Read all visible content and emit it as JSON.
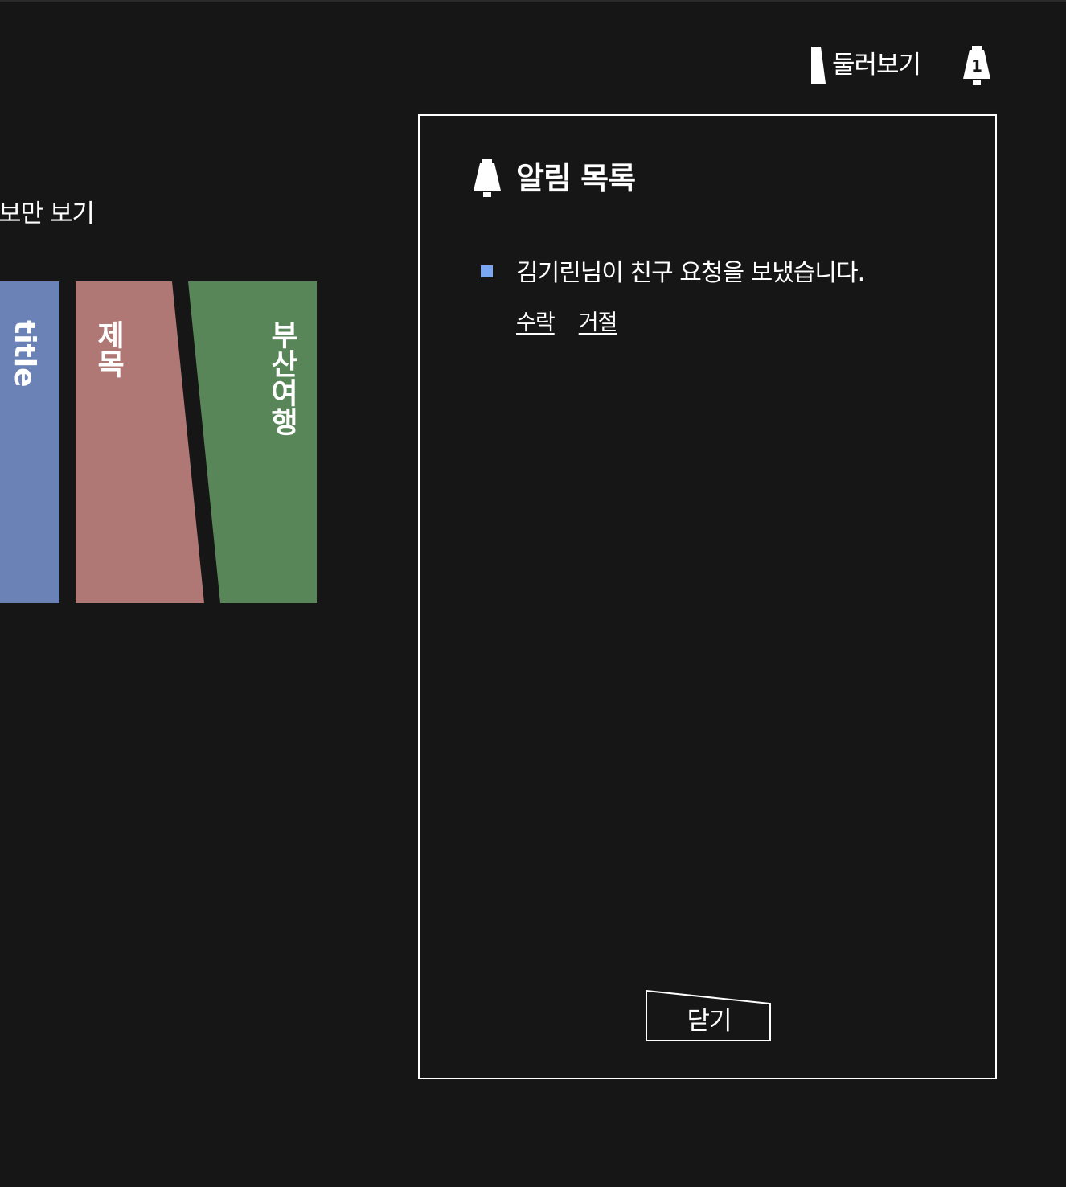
{
  "header": {
    "browse_label": "둘러보기",
    "browse_icon": "bookmark-icon",
    "bell_icon": "bell-icon",
    "notification_count": "1"
  },
  "background": {
    "filter_label": "보만 보기",
    "books": [
      {
        "title": "title",
        "color": "#6a82b6"
      },
      {
        "title": "제목",
        "color": "#b07875"
      },
      {
        "title": "부산여행",
        "color": "#588658"
      }
    ]
  },
  "notifications_panel": {
    "title": "알림 목록",
    "title_icon": "bell-icon",
    "items": [
      {
        "message": "김기린님이 친구 요청을 보냈습니다.",
        "bullet_color": "#7ba6f2",
        "accept_label": "수락",
        "reject_label": "거절"
      }
    ],
    "close_label": "닫기"
  },
  "colors": {
    "background": "#161616",
    "foreground": "#ffffff",
    "accent": "#7ba6f2"
  }
}
